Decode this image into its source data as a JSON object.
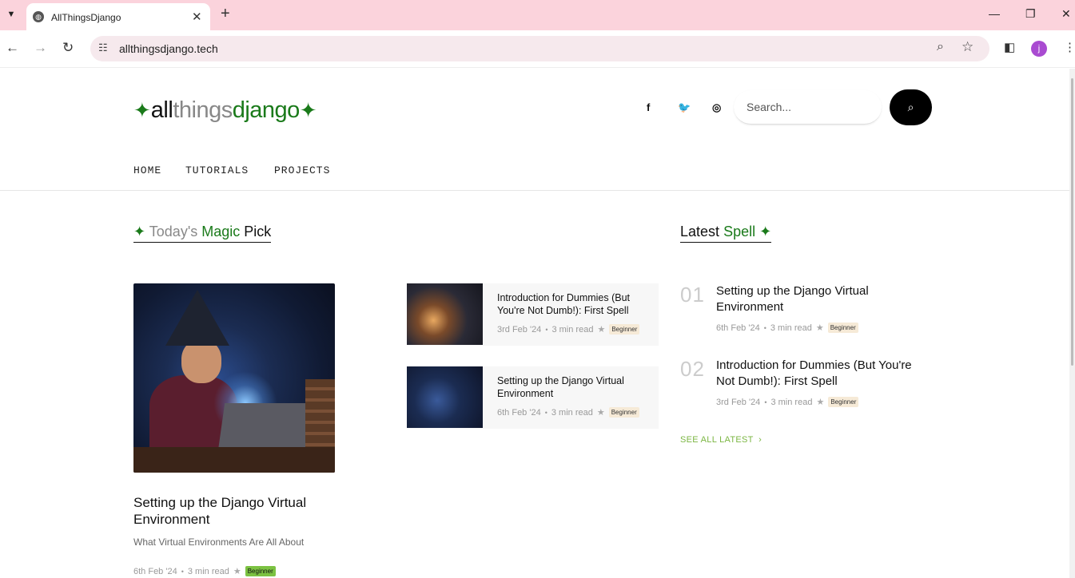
{
  "browser": {
    "tab_title": "AllThingsDjango",
    "url": "allthingsdjango.tech",
    "profile_initial": "j"
  },
  "site": {
    "logo": {
      "part1": "all",
      "part2": "things",
      "part3": "django"
    },
    "search_placeholder": "Search...",
    "menu": [
      "HOME",
      "TUTORIALS",
      "PROJECTS"
    ]
  },
  "magic_pick": {
    "heading": {
      "a": "Today's",
      "b": "Magic",
      "c": "Pick"
    },
    "featured": {
      "title": "Setting up the Django Virtual Environment",
      "subtitle": "What Virtual Environments Are All About",
      "date": "6th Feb '24",
      "read": "3 min read",
      "level": "Beginner"
    },
    "cards": [
      {
        "title": "Introduction for Dummies (But You're Not Dumb!): First Spell",
        "date": "3rd Feb '24",
        "read": "3 min read",
        "level": "Beginner"
      },
      {
        "title": "Setting up the Django Virtual Environment",
        "date": "6th Feb '24",
        "read": "3 min read",
        "level": "Beginner"
      }
    ]
  },
  "latest": {
    "heading": {
      "a": "Latest",
      "b": "Spell"
    },
    "items": [
      {
        "num": "01",
        "title": "Setting up the Django Virtual Environment",
        "date": "6th Feb '24",
        "read": "3 min read",
        "level": "Beginner"
      },
      {
        "num": "02",
        "title": "Introduction for Dummies (But You're Not Dumb!): First Spell",
        "date": "3rd Feb '24",
        "read": "3 min read",
        "level": "Beginner"
      }
    ],
    "see_all": "SEE ALL LATEST"
  },
  "colors": {
    "brand_green": "#1a7a1a",
    "accent_lime": "#7bb642",
    "tab_bar": "#fbd3dc"
  }
}
